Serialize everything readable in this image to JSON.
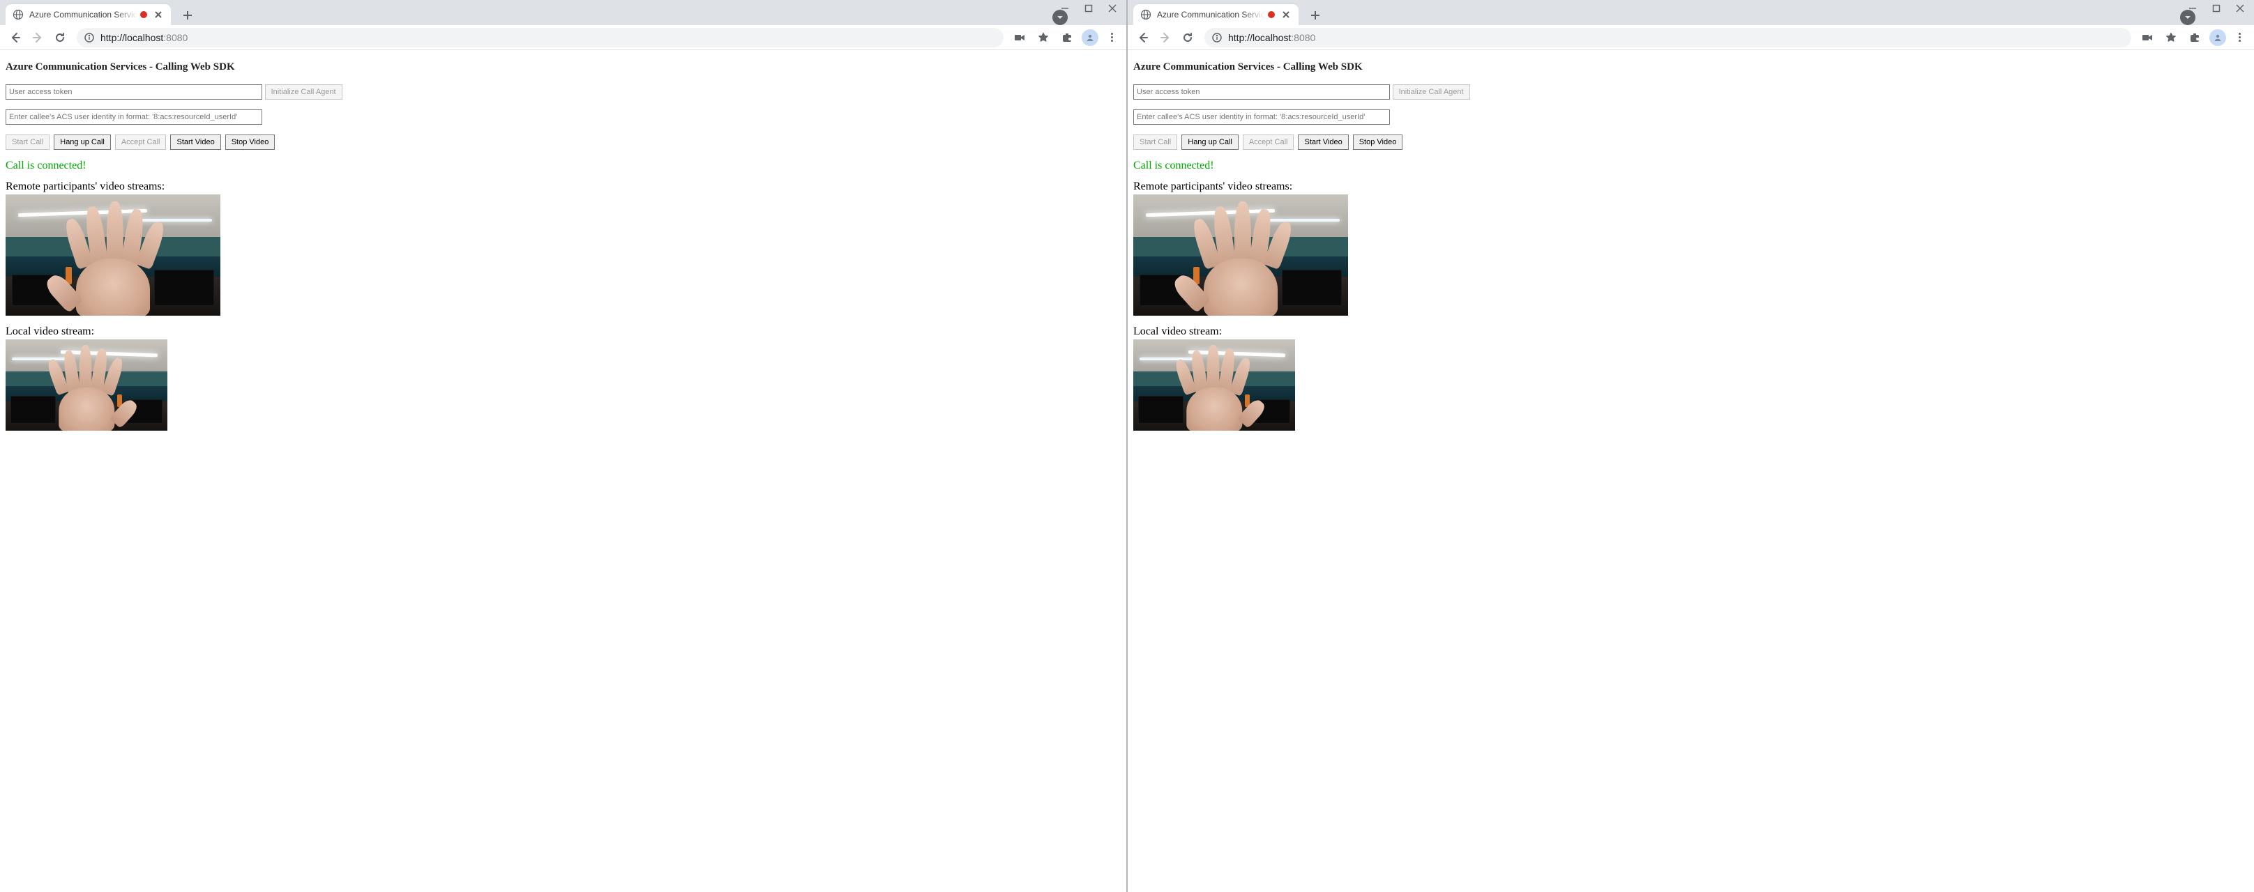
{
  "browser": {
    "tab_title": "Azure Communication Servic",
    "url_host": "http://localhost",
    "url_port": ":8080"
  },
  "page": {
    "heading": "Azure Communication Services - Calling Web SDK",
    "token_placeholder": "User access token",
    "init_agent_label": "Initialize Call Agent",
    "callee_placeholder": "Enter callee's ACS user identity in format: '8:acs:resourceId_userId'",
    "buttons": {
      "start_call": "Start Call",
      "hang_up": "Hang up Call",
      "accept_call": "Accept Call",
      "start_video": "Start Video",
      "stop_video": "Stop Video"
    },
    "status": "Call is connected!",
    "remote_label": "Remote participants' video streams:",
    "local_label": "Local video stream:"
  }
}
